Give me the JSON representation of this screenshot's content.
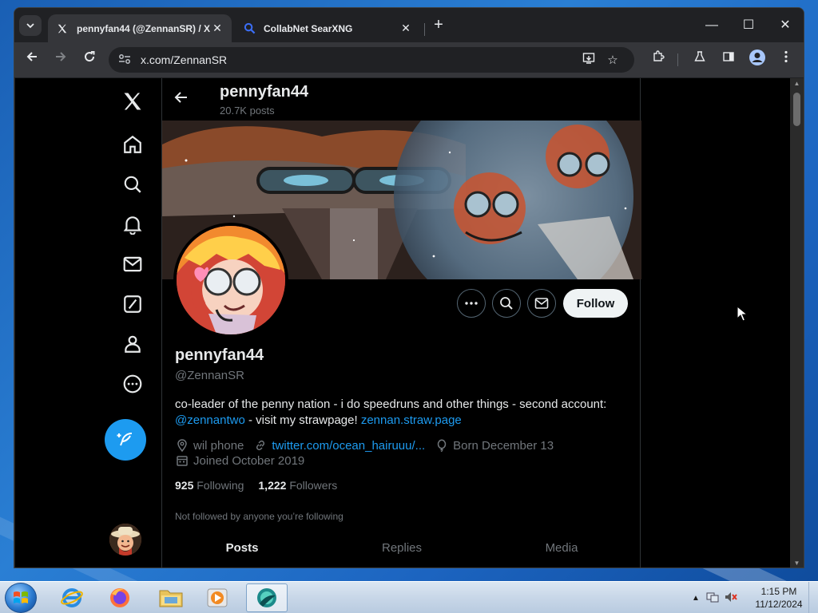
{
  "browser": {
    "tabs": [
      {
        "title": "pennyfan44 (@ZennanSR) / X",
        "icon": "x-logo-icon",
        "active": true
      },
      {
        "title": "CollabNet SearXNG",
        "icon": "search-icon",
        "active": false
      }
    ],
    "url": "x.com/ZennanSR"
  },
  "profile": {
    "header_name": "pennyfan44",
    "header_posts": "20.7K posts",
    "display_name": "pennyfan44",
    "handle": "@ZennanSR",
    "follow_label": "Follow",
    "bio_text_1": "co-leader of the penny nation - i do speedruns and other things - second account: ",
    "bio_link_1": "@zennantwo",
    "bio_text_2": " - visit my strawpage! ",
    "bio_link_2": "zennan.straw.page",
    "location": "wil phone",
    "website": "twitter.com/ocean_hairuuu/...",
    "birthday": "Born December 13",
    "joined": "Joined October 2019",
    "following_count": "925",
    "following_label": "Following",
    "followers_count": "1,222",
    "followers_label": "Followers",
    "not_followed": "Not followed by anyone you’re following",
    "tabs": [
      "Posts",
      "Replies",
      "Media"
    ]
  },
  "taskbar": {
    "time": "1:15 PM",
    "date": "11/12/2024"
  },
  "colors": {
    "accent": "#1d9bf0",
    "background": "#000000",
    "text": "#e7e9ea",
    "muted": "#71767b"
  }
}
